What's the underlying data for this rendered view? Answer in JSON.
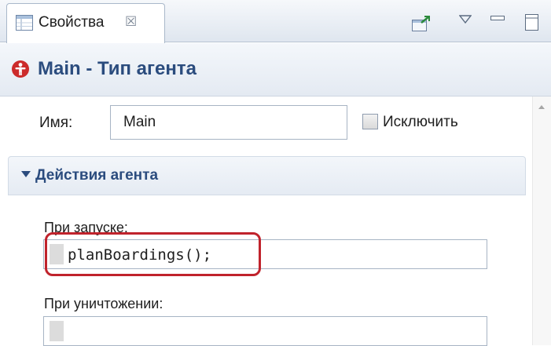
{
  "tab": {
    "label": "Свойства",
    "icon": "properties-icon",
    "close_symbol": "☒"
  },
  "toolbar": {
    "buttons": [
      "pin-to-view-icon",
      "view-menu-icon",
      "minimize-icon",
      "maximize-icon"
    ]
  },
  "title": {
    "text": "Main - Тип агента",
    "icon": "agent-type-icon"
  },
  "name_field": {
    "label": "Имя:",
    "value": "Main"
  },
  "exclude": {
    "label": "Исключить",
    "checked": false
  },
  "section": {
    "title": "Действия агента",
    "expanded": true
  },
  "on_startup": {
    "label": "При запуске:",
    "code": "planBoardings();"
  },
  "on_destroy": {
    "label": "При уничтожении:",
    "code": ""
  },
  "colors": {
    "title_text": "#2b4c7e",
    "highlight_border": "#c0232c",
    "agent_icon": "#cc2b2b"
  }
}
